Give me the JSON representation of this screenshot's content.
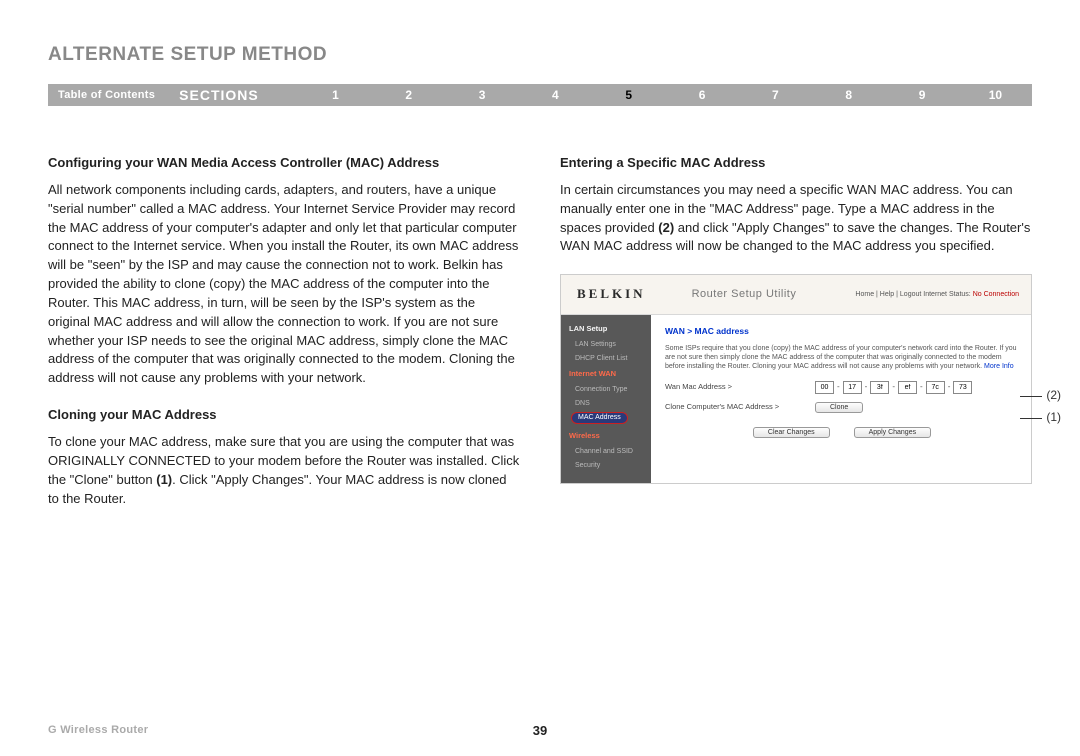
{
  "page_title": "ALTERNATE SETUP METHOD",
  "nav": {
    "toc": "Table of Contents",
    "sections_label": "SECTIONS",
    "numbers": [
      "1",
      "2",
      "3",
      "4",
      "5",
      "6",
      "7",
      "8",
      "9",
      "10"
    ],
    "active_index": 4
  },
  "left": {
    "h1": "Configuring your WAN Media Access Controller (MAC) Address",
    "p1": "All network components including cards, adapters, and routers, have a unique \"serial number\" called a MAC address. Your Internet Service Provider may record the MAC address of your computer's adapter and only let that particular computer connect to the Internet service. When you install the Router, its own MAC address will be \"seen\" by the ISP and may cause the connection not to work. Belkin has provided the ability to clone (copy) the MAC address of the computer into the Router. This MAC address, in turn, will be seen by the ISP's system as the original MAC address and will allow the connection to work. If you are not sure whether your ISP needs to see the original MAC address, simply clone the MAC address of the computer that was originally connected to the modem. Cloning the address will not cause any problems with your network.",
    "h2": "Cloning your MAC Address",
    "p2_a": "To clone your MAC address, make sure that you are using the computer that was ORIGINALLY CONNECTED to your modem before the Router was installed. Click the \"Clone\" button ",
    "p2_b1": "(1)",
    "p2_c": ". Click \"Apply Changes\". Your MAC address is now cloned to the Router."
  },
  "right": {
    "h1": "Entering a Specific MAC Address",
    "p1_a": "In certain circumstances you may need a specific WAN MAC address. You can manually enter one in the \"MAC Address\" page. Type a MAC address in the spaces provided ",
    "p1_b2": "(2)",
    "p1_c": " and click \"Apply Changes\" to save the changes. The Router's WAN MAC address will now be changed to the MAC address you specified."
  },
  "utility": {
    "logo": "BELKIN",
    "title": "Router Setup Utility",
    "toplinks_prefix": "Home | Help | Logout   Internet Status: ",
    "toplinks_status": "No Connection",
    "sidebar": {
      "lan_setup": "LAN Setup",
      "lan_settings": "LAN Settings",
      "dhcp": "DHCP Client List",
      "internet_wan": "Internet WAN",
      "conn_type": "Connection Type",
      "dns": "DNS",
      "mac_addr": "MAC Address",
      "wireless": "Wireless",
      "chan_ssid": "Channel and SSID",
      "security": "Security"
    },
    "content": {
      "breadcrumb": "WAN > MAC address",
      "desc": "Some ISPs require that you clone (copy) the MAC address of your computer's network card into the Router. If you are not sure then simply clone the MAC address of the computer that was originally connected to the modem before installing the Router. Cloning your MAC address will not cause any problems with your network. ",
      "more": "More Info",
      "row1_label": "Wan Mac Address >",
      "mac": [
        "00",
        "17",
        "3f",
        "ef",
        "7c",
        "73"
      ],
      "row2_label": "Clone Computer's MAC Address >",
      "clone_btn": "Clone",
      "clear_btn": "Clear Changes",
      "apply_btn": "Apply Changes"
    },
    "callouts": {
      "c1": "(1)",
      "c2": "(2)"
    }
  },
  "footer": {
    "left": "G Wireless Router",
    "page": "39"
  }
}
